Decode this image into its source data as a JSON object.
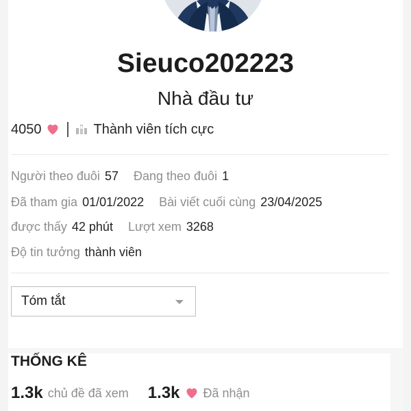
{
  "profile": {
    "username": "Sieuco202223",
    "title": "Nhà đầu tư",
    "reaction_score": "4050",
    "badge_label": "Thành viên tích cực"
  },
  "details": {
    "followers": {
      "label": "Người theo đuôi",
      "value": "57"
    },
    "following": {
      "label": "Đang theo đuôi",
      "value": "1"
    },
    "joined": {
      "label": "Đã tham gia",
      "value": "01/01/2022"
    },
    "last_post": {
      "label": "Bài viết cuối cùng",
      "value": "23/04/2025"
    },
    "seen": {
      "label": "được thấy",
      "value": "42 phút"
    },
    "views": {
      "label": "Lượt xem",
      "value": "3268"
    },
    "trust": {
      "label": "Độ tin tưởng",
      "value": "thành viên"
    }
  },
  "summary_dropdown": {
    "selected": "Tóm tắt"
  },
  "stats": {
    "heading": "THỐNG KÊ",
    "topics_viewed": {
      "value": "1.3k",
      "label": "chủ đề đã xem"
    },
    "likes_received": {
      "value": "1.3k",
      "label": "Đã nhận"
    }
  },
  "colors": {
    "heart": "#ee6f8d",
    "badge": "#b7b7b7",
    "muted_text": "#8e8e8e",
    "page_background": "#f4f4f4"
  },
  "icons": {
    "reaction": "heart-icon",
    "badge": "badge-icon",
    "dropdown": "caret-down-icon",
    "likes": "heart-icon"
  }
}
